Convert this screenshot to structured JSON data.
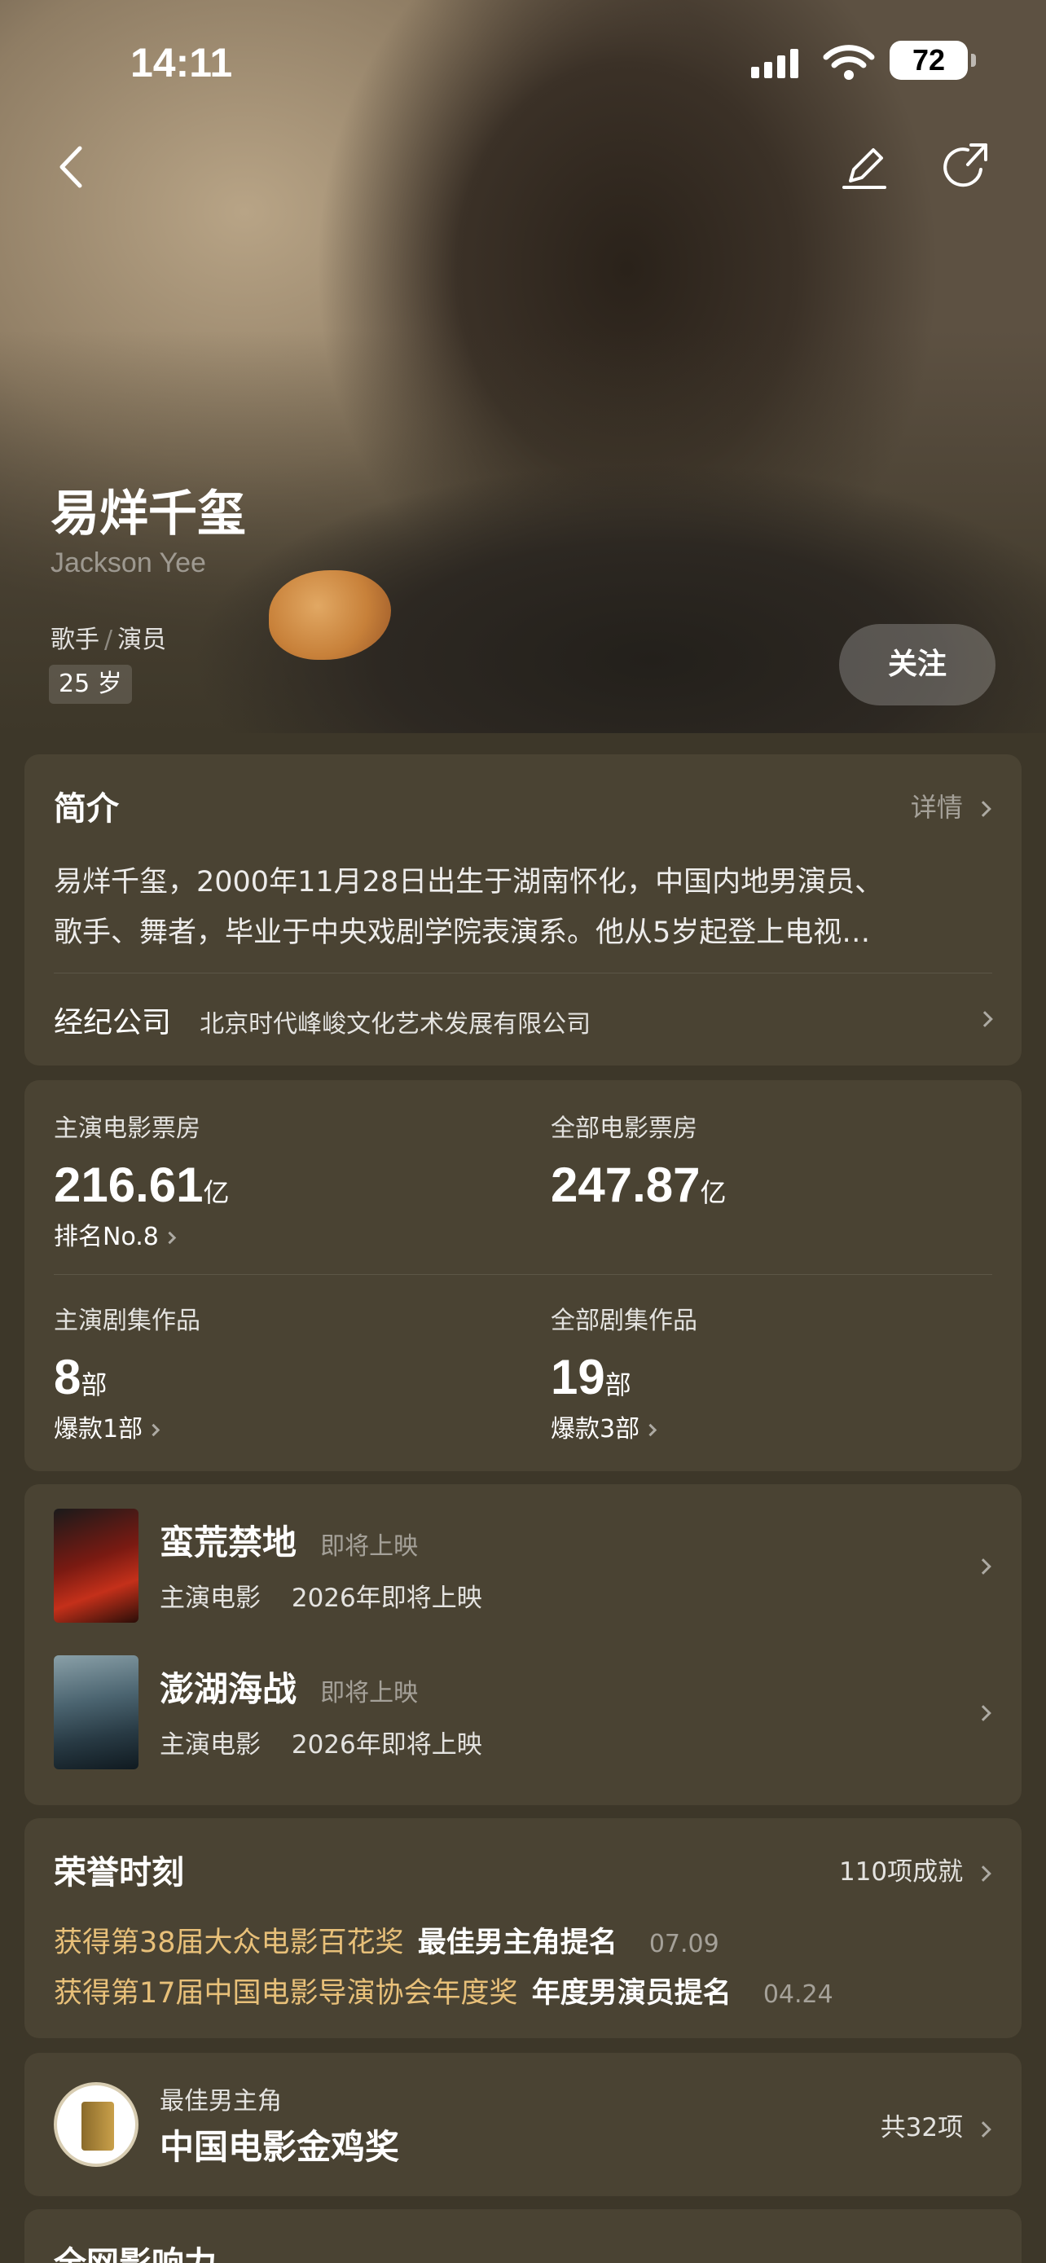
{
  "status": {
    "time": "14:11",
    "battery": "72"
  },
  "profile": {
    "name": "易烊千玺",
    "english_name": "Jackson Yee",
    "roles": [
      "歌手",
      "演员"
    ],
    "role_sep": "/",
    "age": "25 岁",
    "follow_label": "关注"
  },
  "intro": {
    "title": "简介",
    "detail_label": "详情",
    "line1": "易烊千玺，2000年11月28日出生于湖南怀化，中国内地男演员、",
    "line2": "歌手、舞者，毕业于中央戏剧学院表演系。他从5岁起登上电视…",
    "agency_label": "经纪公司",
    "agency_name": "北京时代峰峻文化艺术发展有限公司"
  },
  "stats": {
    "lead_box_label": "主演电影票房",
    "lead_box_value": "216.61",
    "lead_box_unit": "亿",
    "lead_box_rank": "排名No.8",
    "all_box_label": "全部电影票房",
    "all_box_value": "247.87",
    "all_box_unit": "亿",
    "lead_series_label": "主演剧集作品",
    "lead_series_value": "8",
    "lead_series_unit": "部",
    "lead_series_hits": "爆款1部",
    "all_series_label": "全部剧集作品",
    "all_series_value": "19",
    "all_series_unit": "部",
    "all_series_hits": "爆款3部"
  },
  "upcoming": [
    {
      "title": "蛮荒禁地",
      "status": "即将上映",
      "role": "主演电影",
      "date": "2026年即将上映"
    },
    {
      "title": "澎湖海战",
      "status": "即将上映",
      "role": "主演电影",
      "date": "2026年即将上映"
    }
  ],
  "honors": {
    "title": "荣誉时刻",
    "count": "110项成就",
    "items": [
      {
        "event": "获得第38届大众电影百花奖",
        "award": "最佳男主角提名",
        "date": "07.09"
      },
      {
        "event": "获得第17届中国电影导演协会年度奖",
        "award": "年度男演员提名",
        "date": "04.24"
      }
    ]
  },
  "award_card": {
    "subtitle": "最佳男主角",
    "name": "中国电影金鸡奖",
    "count": "共32项"
  },
  "influence": {
    "title": "全网影响力"
  },
  "colors": {
    "background": "#3d3729",
    "card": "#4a4333",
    "gold": "#e8c079"
  }
}
